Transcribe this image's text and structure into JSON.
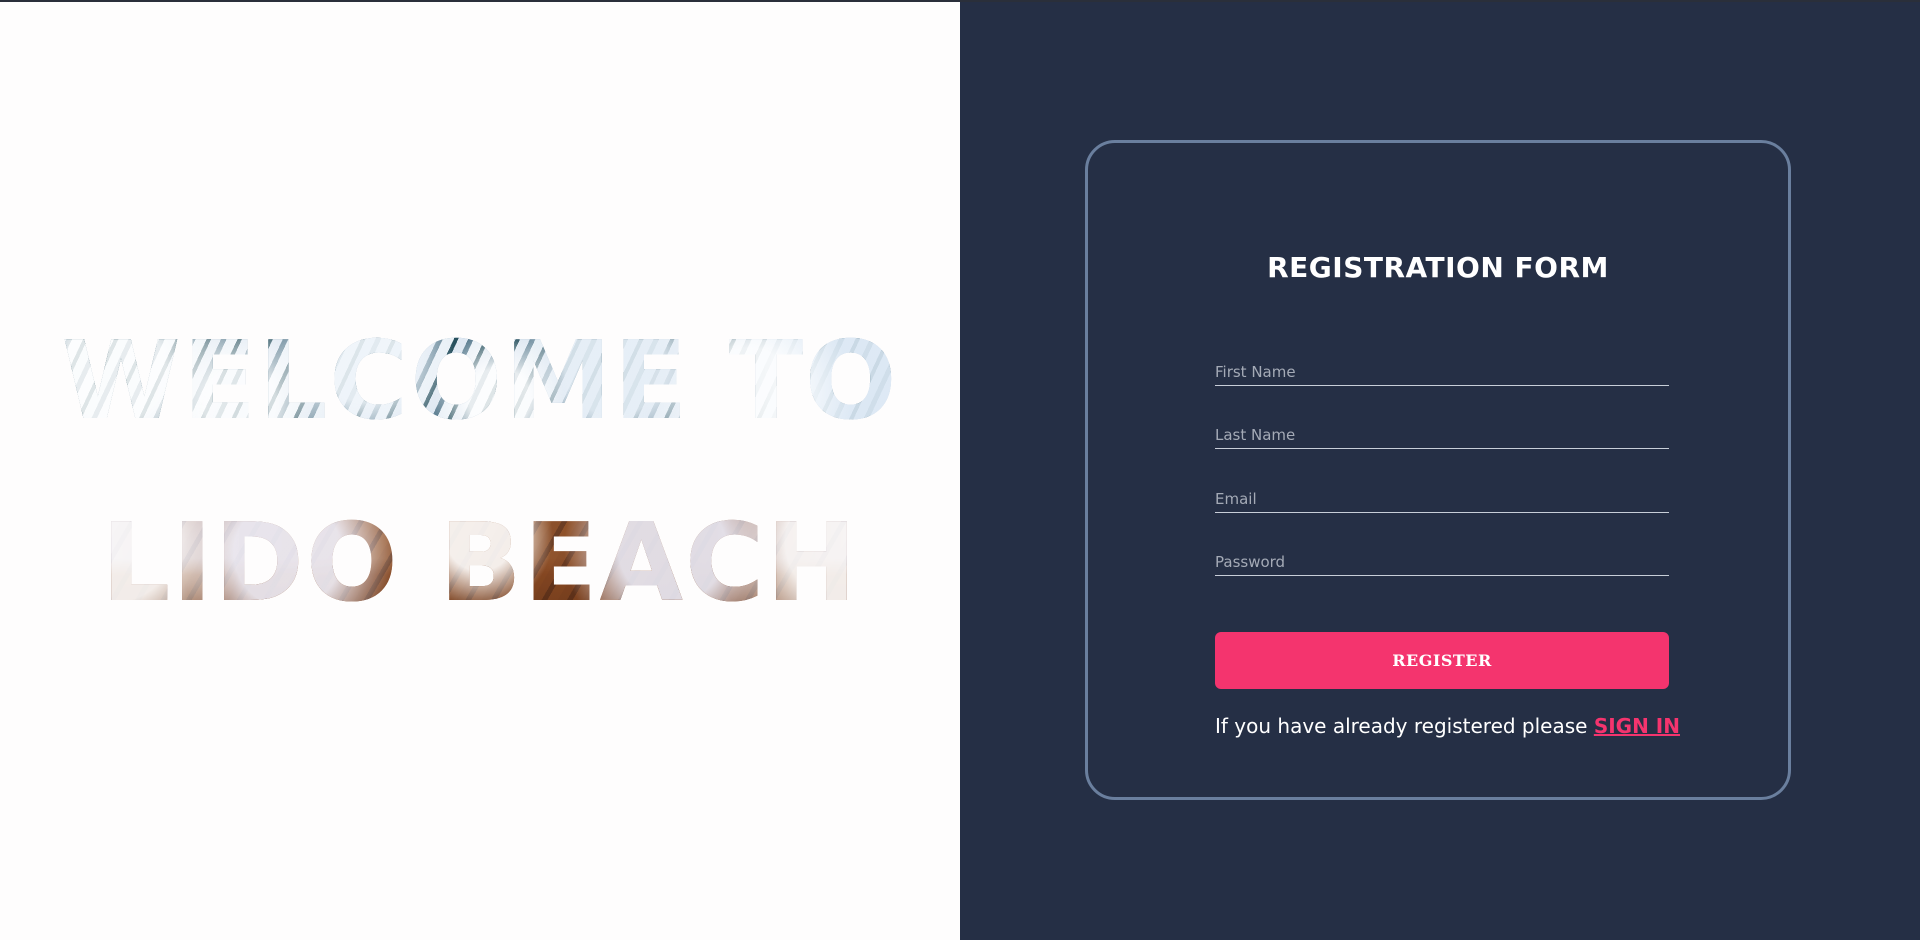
{
  "hero": {
    "line1": "WELCOME TO",
    "line2": "LIDO BEACH"
  },
  "form": {
    "title": "REGISTRATION FORM",
    "fields": {
      "first_name": {
        "placeholder": "First Name",
        "value": ""
      },
      "last_name": {
        "placeholder": "Last Name",
        "value": ""
      },
      "email": {
        "placeholder": "Email",
        "value": ""
      },
      "password": {
        "placeholder": "Password",
        "value": ""
      }
    },
    "register_label": "REGISTER",
    "signin_prompt": "If you have already registered please ",
    "signin_label": "SIGN IN"
  },
  "colors": {
    "left_background": "#fefdfd",
    "right_background": "#252f45",
    "card_border": "#6a7f9e",
    "accent": "#f4346e",
    "text": "#ffffff",
    "placeholder": "#a4aab6"
  }
}
